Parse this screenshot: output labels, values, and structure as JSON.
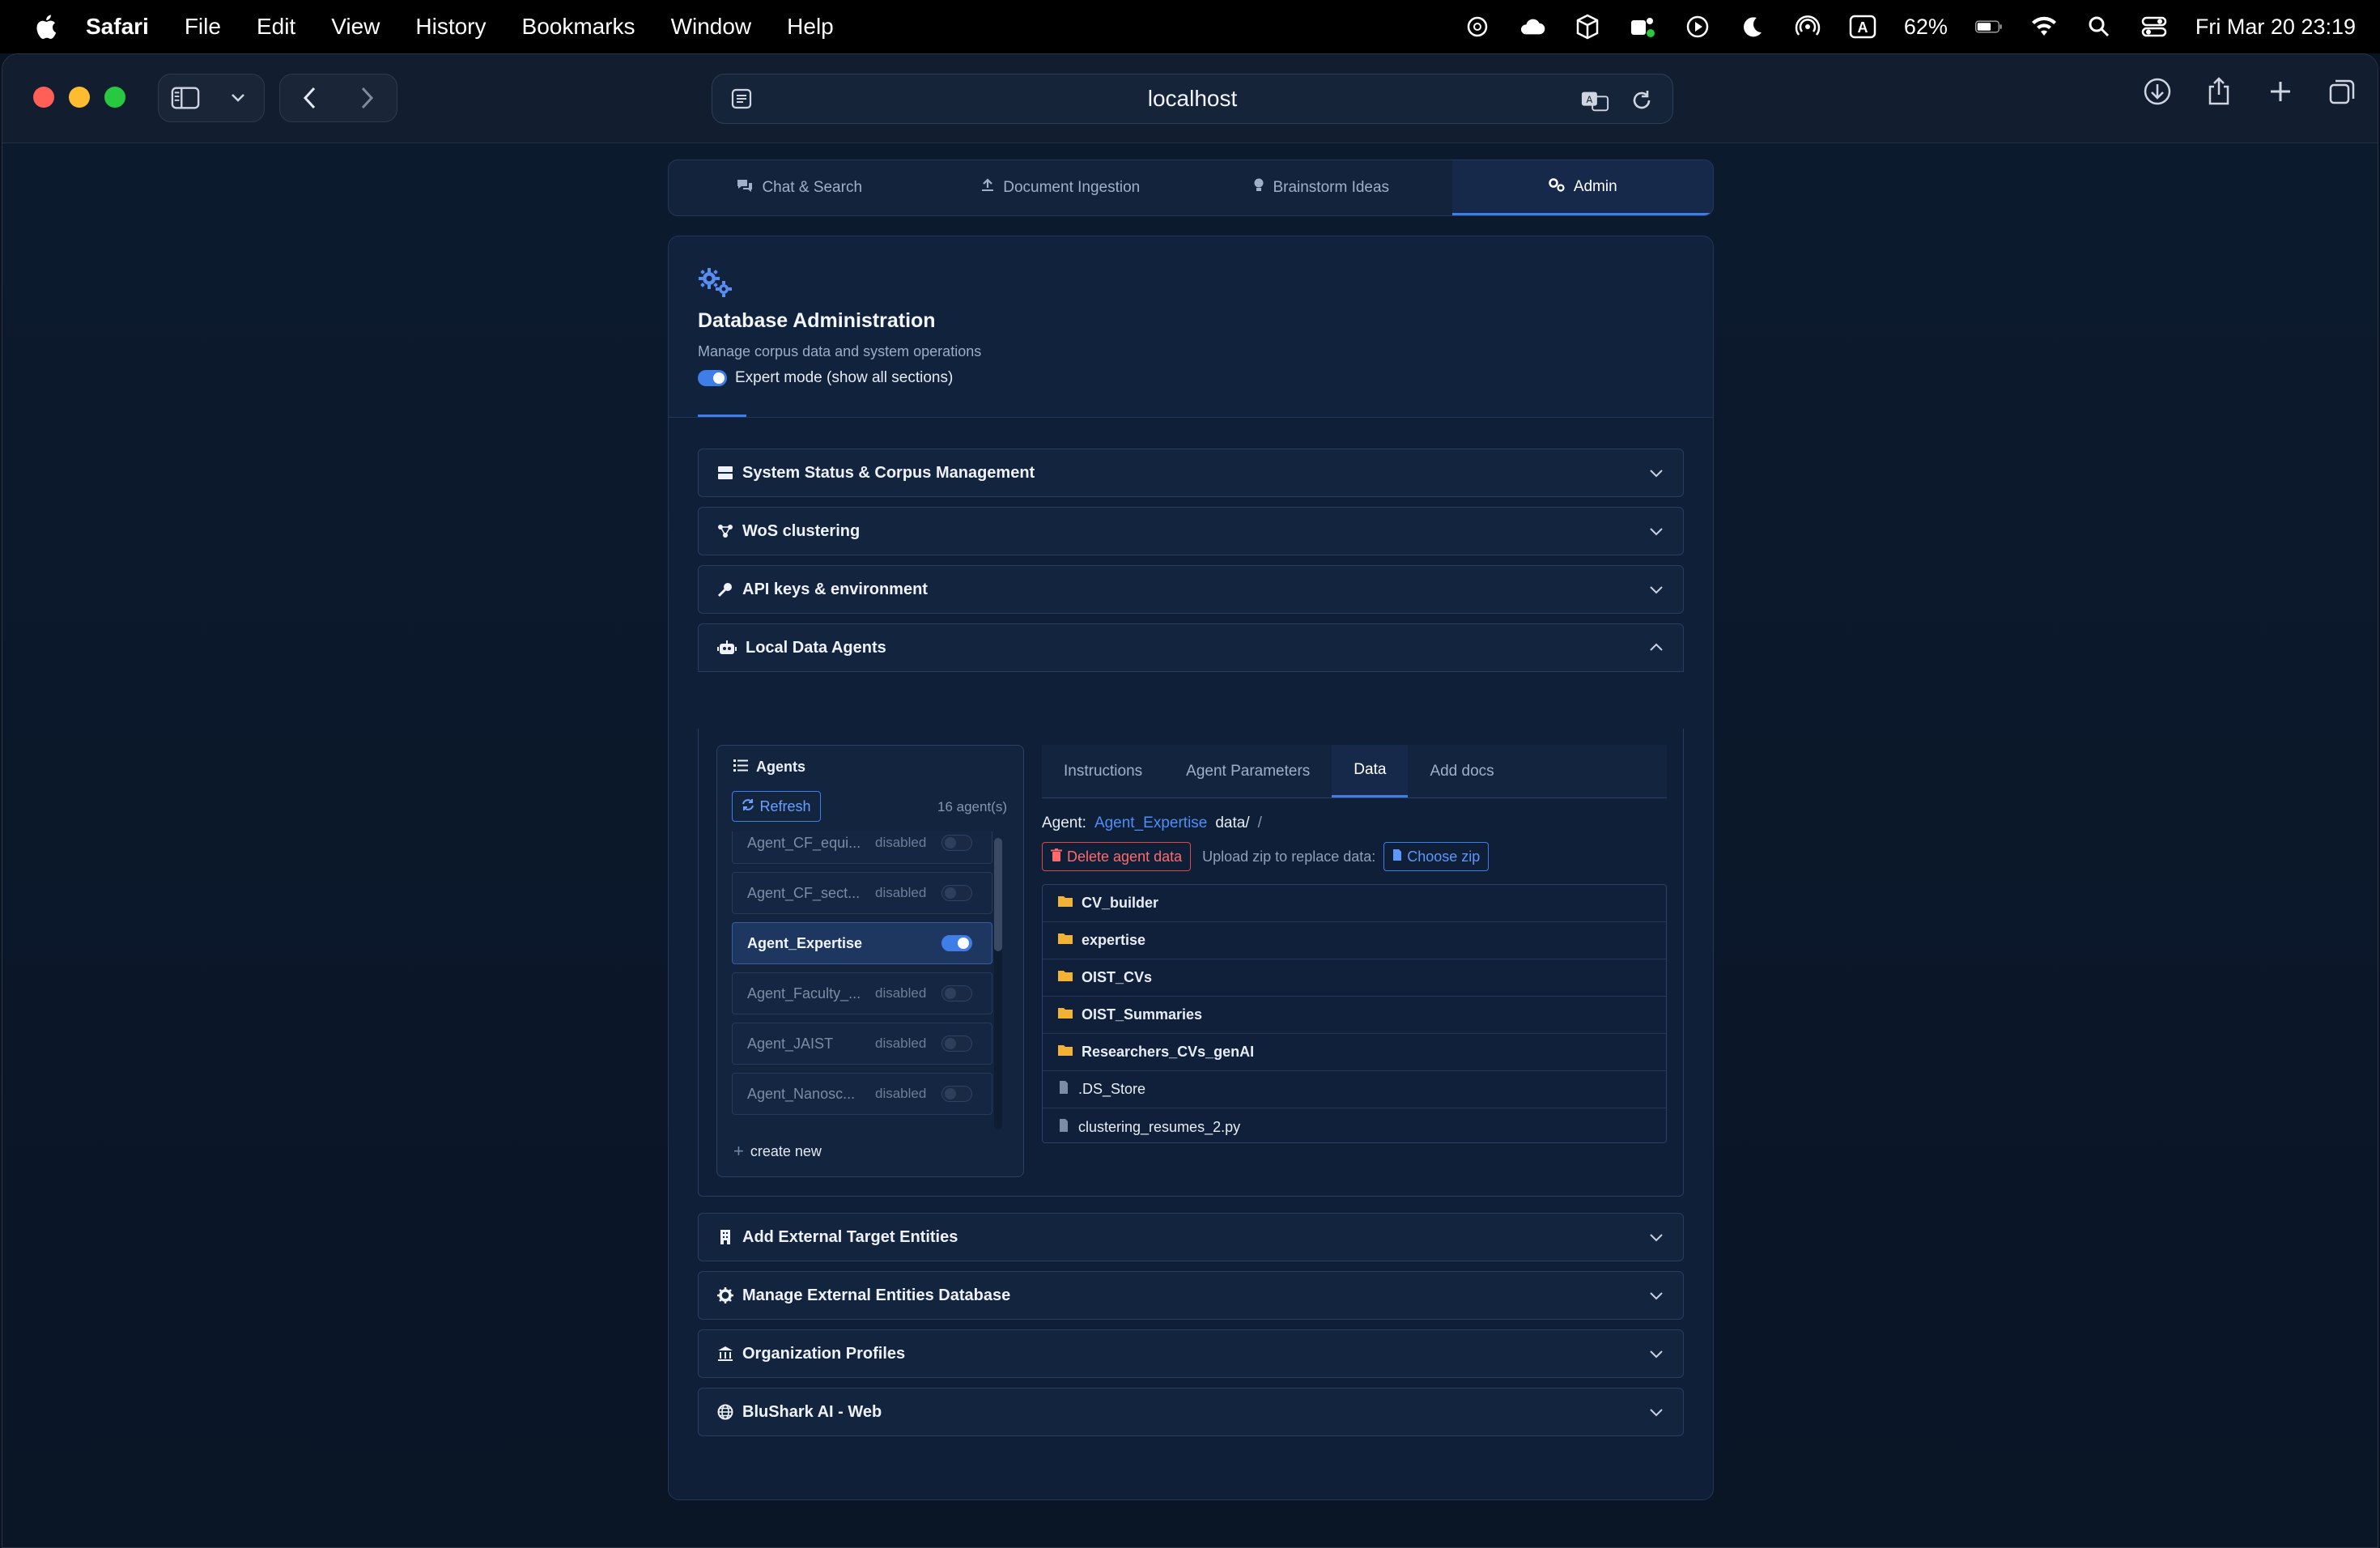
{
  "menubar": {
    "app": "Safari",
    "items": [
      "File",
      "Edit",
      "View",
      "History",
      "Bookmarks",
      "Window",
      "Help"
    ],
    "battery": "62%",
    "datetime": "Fri Mar 20  23:19"
  },
  "browser": {
    "url": "localhost"
  },
  "tabs": [
    {
      "label": "Chat & Search",
      "icon": "comments-icon",
      "active": false
    },
    {
      "label": "Document Ingestion",
      "icon": "upload-icon",
      "active": false
    },
    {
      "label": "Brainstorm Ideas",
      "icon": "lightbulb-icon",
      "active": false
    },
    {
      "label": "Admin",
      "icon": "gears-icon",
      "active": true
    }
  ],
  "admin": {
    "title": "Database Administration",
    "subtitle": "Manage corpus data and system operations",
    "expert_mode_label": "Expert mode (show all sections)"
  },
  "sections": [
    {
      "label": "System Status & Corpus Management",
      "icon": "server-icon"
    },
    {
      "label": "WoS clustering",
      "icon": "network-icon"
    },
    {
      "label": "API keys & environment",
      "icon": "key-icon"
    },
    {
      "label": "Local Data Agents",
      "icon": "robot-icon",
      "expanded": true
    },
    {
      "label": "Add External Target Entities",
      "icon": "building-icon"
    },
    {
      "label": "Manage External Entities Database",
      "icon": "gear-icon"
    },
    {
      "label": "Organization Profiles",
      "icon": "bank-icon"
    },
    {
      "label": "BluShark AI - Web",
      "icon": "globe-icon"
    }
  ],
  "agents_panel": {
    "title": "Agents",
    "refresh_label": "Refresh",
    "count": "16 agent(s)",
    "create_label": "create new",
    "agents": [
      {
        "name": "Agent_CF_equi...",
        "status": "disabled",
        "enabled": false
      },
      {
        "name": "Agent_CF_sect...",
        "status": "disabled",
        "enabled": false
      },
      {
        "name": "Agent_Expertise",
        "status": "",
        "enabled": true
      },
      {
        "name": "Agent_Faculty_...",
        "status": "disabled",
        "enabled": false
      },
      {
        "name": "Agent_JAIST",
        "status": "disabled",
        "enabled": false
      },
      {
        "name": "Agent_Nanosc...",
        "status": "disabled",
        "enabled": false
      }
    ]
  },
  "data_tabs": [
    "Instructions",
    "Agent Parameters",
    "Data",
    "Add docs"
  ],
  "data_view": {
    "agent_label": "Agent:",
    "agent_name": "Agent_Expertise",
    "path": "data/",
    "path_sep": "/",
    "delete_label": "Delete agent data",
    "upload_label": "Upload zip to replace data:",
    "choose_label": "Choose zip",
    "files": [
      {
        "name": "CV_builder",
        "type": "folder"
      },
      {
        "name": "expertise",
        "type": "folder"
      },
      {
        "name": "OIST_CVs",
        "type": "folder"
      },
      {
        "name": "OIST_Summaries",
        "type": "folder"
      },
      {
        "name": "Researchers_CVs_genAI",
        "type": "folder"
      },
      {
        "name": ".DS_Store",
        "type": "file"
      },
      {
        "name": "clustering_resumes_2.py",
        "type": "file"
      }
    ]
  },
  "colors": {
    "accent": "#3f7de8",
    "folder": "#f2b233",
    "danger": "#d94848"
  }
}
